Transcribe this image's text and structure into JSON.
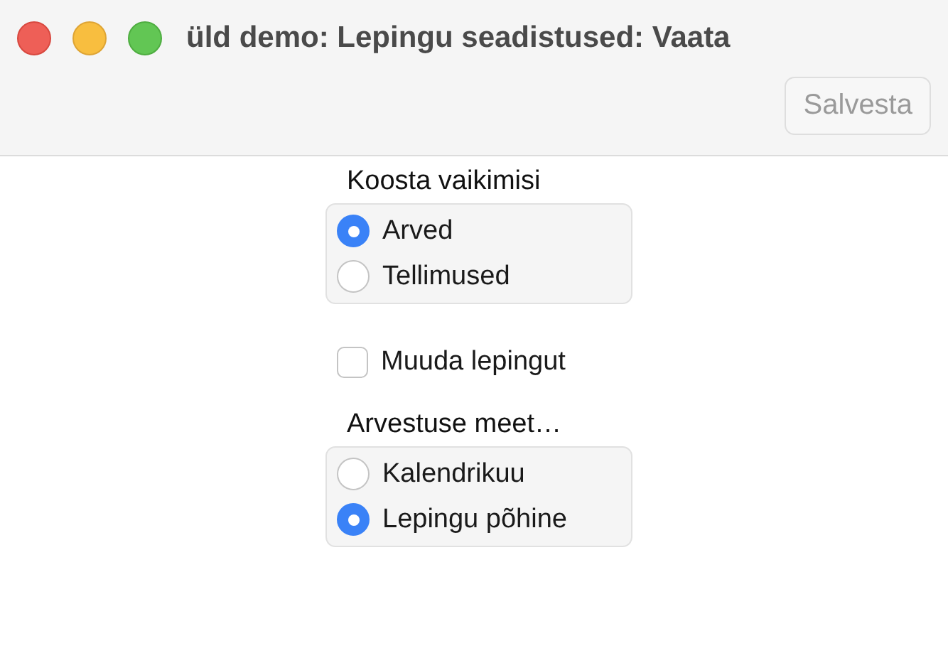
{
  "window": {
    "title": "üld demo: Lepingu seadistused: Vaata"
  },
  "toolbar": {
    "save_button": {
      "label": "Salvesta",
      "disabled": true
    }
  },
  "default_compose": {
    "label": "Koosta vaikimisi",
    "options": [
      {
        "label": "Arved",
        "selected": true
      },
      {
        "label": "Tellimused",
        "selected": false
      }
    ]
  },
  "edit_contract": {
    "label": "Muuda lepingut",
    "checked": false
  },
  "billing_method": {
    "label": "Arvestuse meet…",
    "options": [
      {
        "label": "Kalendrikuu",
        "selected": false
      },
      {
        "label": "Lepingu põhine",
        "selected": true
      }
    ]
  }
}
